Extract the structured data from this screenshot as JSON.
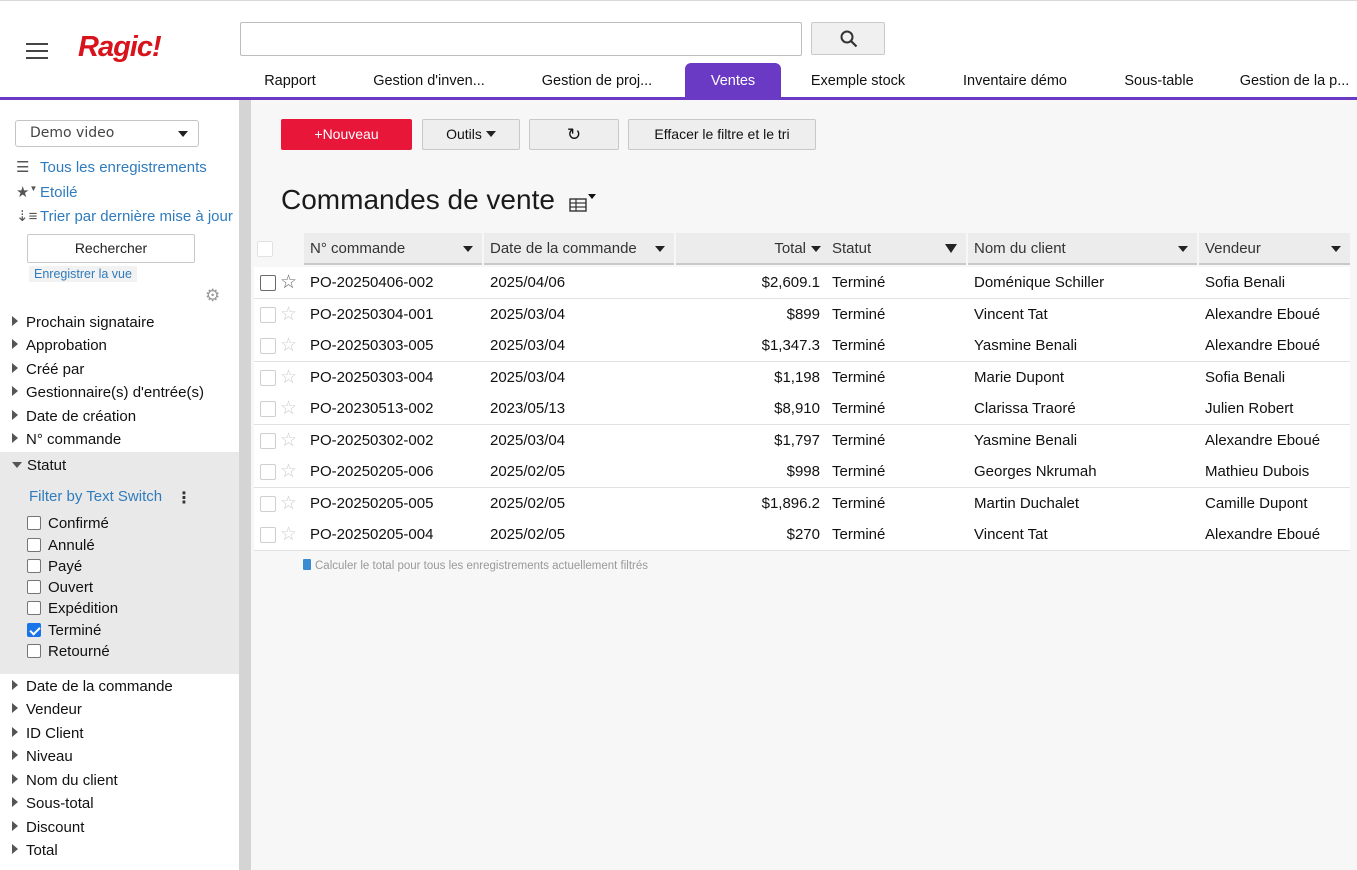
{
  "app": {
    "logo": "Ragic!"
  },
  "search": {
    "placeholder": ""
  },
  "tabs": [
    {
      "label": "Rapport"
    },
    {
      "label": "Gestion d'inven..."
    },
    {
      "label": "Gestion de proj..."
    },
    {
      "label": "Ventes",
      "active": true
    },
    {
      "label": "Exemple stock"
    },
    {
      "label": "Inventaire démo"
    },
    {
      "label": "Sous-table"
    },
    {
      "label": "Gestion de la p..."
    }
  ],
  "sidebar": {
    "view_select": "Demo video",
    "links": [
      {
        "icon": "list-icon",
        "label": "Tous les enregistrements"
      },
      {
        "icon": "star-icon",
        "label": "Etoilé"
      },
      {
        "icon": "sort-icon",
        "label": "Trier par dernière mise à jour"
      }
    ],
    "search_button": "Rechercher",
    "save_view": "Enregistrer la vue",
    "fields_before": [
      "Prochain signataire",
      "Approbation",
      "Créé par",
      "Gestionnaire(s) d'entrée(s)",
      "Date de création",
      "N° commande"
    ],
    "statut": {
      "label": "Statut",
      "filter_mode": "Filter by Text Switch",
      "options": [
        {
          "label": "Confirmé",
          "checked": false
        },
        {
          "label": "Annulé",
          "checked": false
        },
        {
          "label": "Payé",
          "checked": false
        },
        {
          "label": "Ouvert",
          "checked": false
        },
        {
          "label": "Expédition",
          "checked": false
        },
        {
          "label": "Terminé",
          "checked": true
        },
        {
          "label": "Retourné",
          "checked": false
        }
      ]
    },
    "fields_after": [
      "Date de la commande",
      "Vendeur",
      "ID Client",
      "Niveau",
      "Nom du client",
      "Sous-total",
      "Discount",
      "Total"
    ]
  },
  "toolbar": {
    "new_label": "+Nouveau",
    "tools_label": "Outils",
    "clear_label": "Effacer le filtre et le tri"
  },
  "page_title": "Commandes de vente",
  "table": {
    "columns": [
      "N° commande",
      "Date de la commande",
      "Total",
      "Statut",
      "Nom du client",
      "Vendeur"
    ],
    "rows": [
      [
        "PO-20250406-002",
        "2025/04/06",
        "$2,609.1",
        "Terminé",
        "Doménique Schiller",
        "Sofia Benali"
      ],
      [
        "PO-20250304-001",
        "2025/03/04",
        "$899",
        "Terminé",
        "Vincent Tat",
        "Alexandre Eboué"
      ],
      [
        "PO-20250303-005",
        "2025/03/04",
        "$1,347.3",
        "Terminé",
        "Yasmine Benali",
        "Alexandre Eboué"
      ],
      [
        "PO-20250303-004",
        "2025/03/04",
        "$1,198",
        "Terminé",
        "Marie Dupont",
        "Sofia Benali"
      ],
      [
        "PO-20230513-002",
        "2023/05/13",
        "$8,910",
        "Terminé",
        "Clarissa Traoré",
        "Julien Robert"
      ],
      [
        "PO-20250302-002",
        "2025/03/04",
        "$1,797",
        "Terminé",
        "Yasmine Benali",
        "Alexandre Eboué"
      ],
      [
        "PO-20250205-006",
        "2025/02/05",
        "$998",
        "Terminé",
        "Georges Nkrumah",
        "Mathieu Dubois"
      ],
      [
        "PO-20250205-005",
        "2025/02/05",
        "$1,896.2",
        "Terminé",
        "Martin Duchalet",
        "Camille Dupont"
      ],
      [
        "PO-20250205-004",
        "2025/02/05",
        "$270",
        "Terminé",
        "Vincent Tat",
        "Alexandre Eboué"
      ]
    ],
    "calc_link": "Calculer le total pour tous les enregistrements actuellement filtrés"
  },
  "colors": {
    "accent": "#6a3ac5",
    "new_button": "#e8173a",
    "link": "#2f7bbd",
    "logo": "#d7131c"
  }
}
